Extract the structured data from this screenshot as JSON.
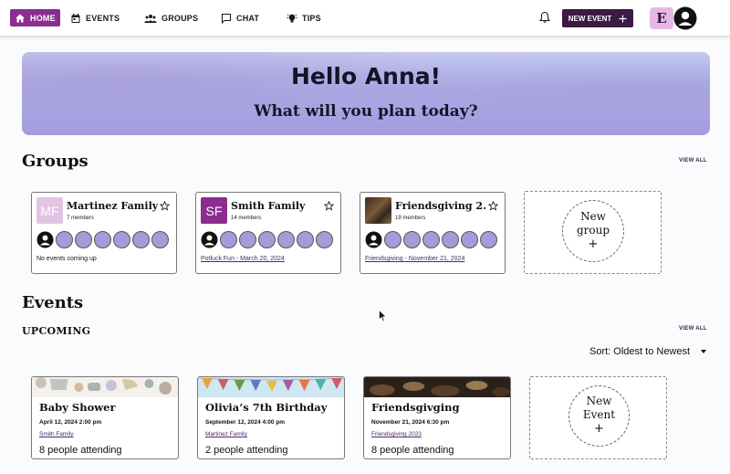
{
  "nav": {
    "items": [
      {
        "label": "HOME",
        "icon": "home-icon"
      },
      {
        "label": "EVENTS",
        "icon": "calendar-icon"
      },
      {
        "label": "GROUPS",
        "icon": "people-icon"
      },
      {
        "label": "CHAT",
        "icon": "chat-icon"
      },
      {
        "label": "TIPS",
        "icon": "lightbulb-icon"
      }
    ],
    "new_event_label": "NEW EVENT",
    "logo_text": "E",
    "accent": "#8a2d8e",
    "dark": "#3b1a45"
  },
  "banner": {
    "greeting": "Hello Anna!",
    "question": "What will you plan today?"
  },
  "groups": {
    "title": "Groups",
    "view_all": "VIEW ALL",
    "cards": [
      {
        "name": "Martinez Family",
        "members": "7 members",
        "initials": "MF",
        "thumb_color": "#e2c4e3",
        "event": "No events coming up",
        "event_is_link": false
      },
      {
        "name": "Smith Family",
        "members": "14 members",
        "initials": "SF",
        "thumb_color": "#8a2d8e",
        "event": "Potluck Fun - March 20, 2024",
        "event_is_link": true
      },
      {
        "name": "Friendsgiving 2...",
        "members": "19 members",
        "initials": "",
        "thumb_color": "#5a4030",
        "event": "Friendsgiving - November 21, 2024",
        "event_is_link": true
      }
    ],
    "new_group": {
      "line1": "New",
      "line2": "group",
      "plus": "+"
    }
  },
  "events": {
    "title": "Events",
    "upcoming": "UPCOMING",
    "view_all": "VIEW ALL",
    "sort_label": "Sort:",
    "sort_value": "Oldest to Newest",
    "cards": [
      {
        "name": "Baby Shower",
        "date": "April 12, 2024 2:00 pm",
        "group": "Smith Family",
        "attending": "8 people attending"
      },
      {
        "name": "Olivia’s 7th Birthday",
        "date": "September 12, 2024 4:00 pm",
        "group": "Martinez Family",
        "attending": "2 people attending"
      },
      {
        "name": "Friendsgivging",
        "date": "November 21, 2024 6:30 pm",
        "group": "Friendsgiving 2023",
        "attending": "8 people attending"
      }
    ],
    "new_event": {
      "line1": "New",
      "line2": "Event",
      "plus": "+"
    }
  }
}
